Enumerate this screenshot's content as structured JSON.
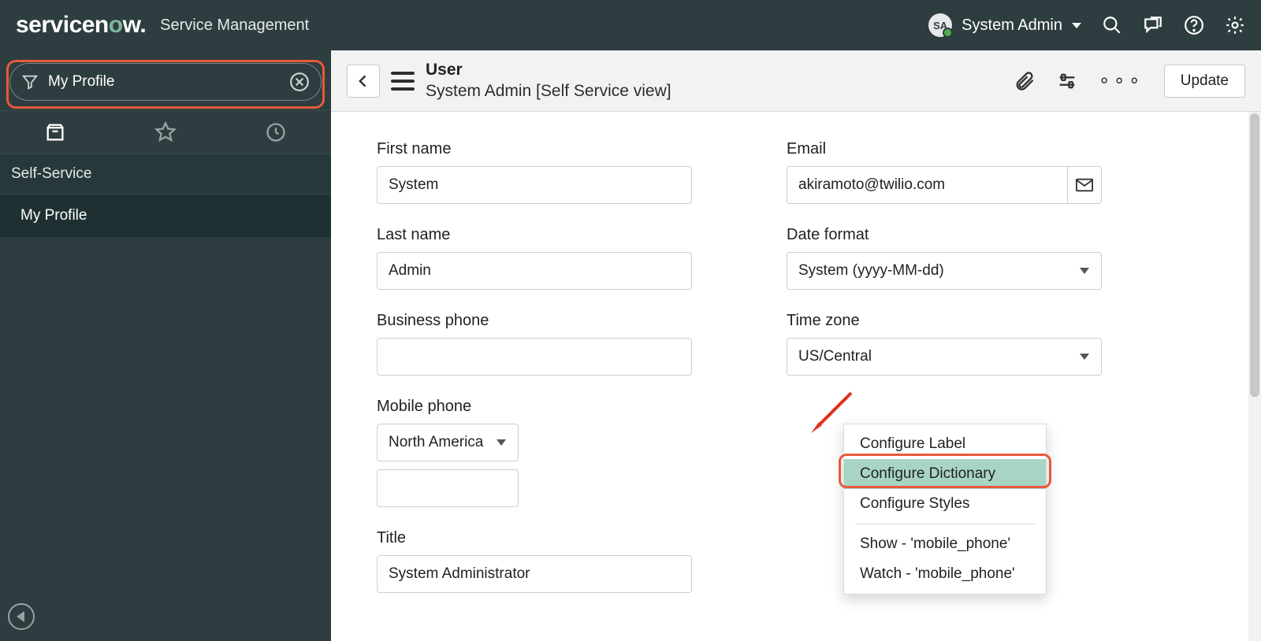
{
  "banner": {
    "logo_prefix": "servicen",
    "logo_o": "o",
    "logo_suffix": "w",
    "product": "Service Management",
    "avatar_initials": "SA",
    "username": "System Admin"
  },
  "nav": {
    "filter_value": "My Profile",
    "app_header": "Self-Service",
    "module": "My Profile"
  },
  "form_header": {
    "title": "User",
    "subtitle": "System Admin [Self Service view]",
    "update": "Update"
  },
  "form": {
    "first_name_label": "First name",
    "first_name_value": "System",
    "last_name_label": "Last name",
    "last_name_value": "Admin",
    "business_phone_label": "Business phone",
    "business_phone_value": "",
    "mobile_phone_label": "Mobile phone",
    "mobile_phone_region": "North America",
    "mobile_phone_value": "",
    "title_label": "Title",
    "title_value": "System Administrator",
    "email_label": "Email",
    "email_value": "akiramoto@twilio.com",
    "date_format_label": "Date format",
    "date_format_value": "System (yyyy-MM-dd)",
    "time_zone_label": "Time zone",
    "time_zone_value": "US/Central"
  },
  "context_menu": {
    "items": [
      "Configure Label",
      "Configure Dictionary",
      "Configure Styles",
      "Show - 'mobile_phone'",
      "Watch - 'mobile_phone'"
    ]
  }
}
